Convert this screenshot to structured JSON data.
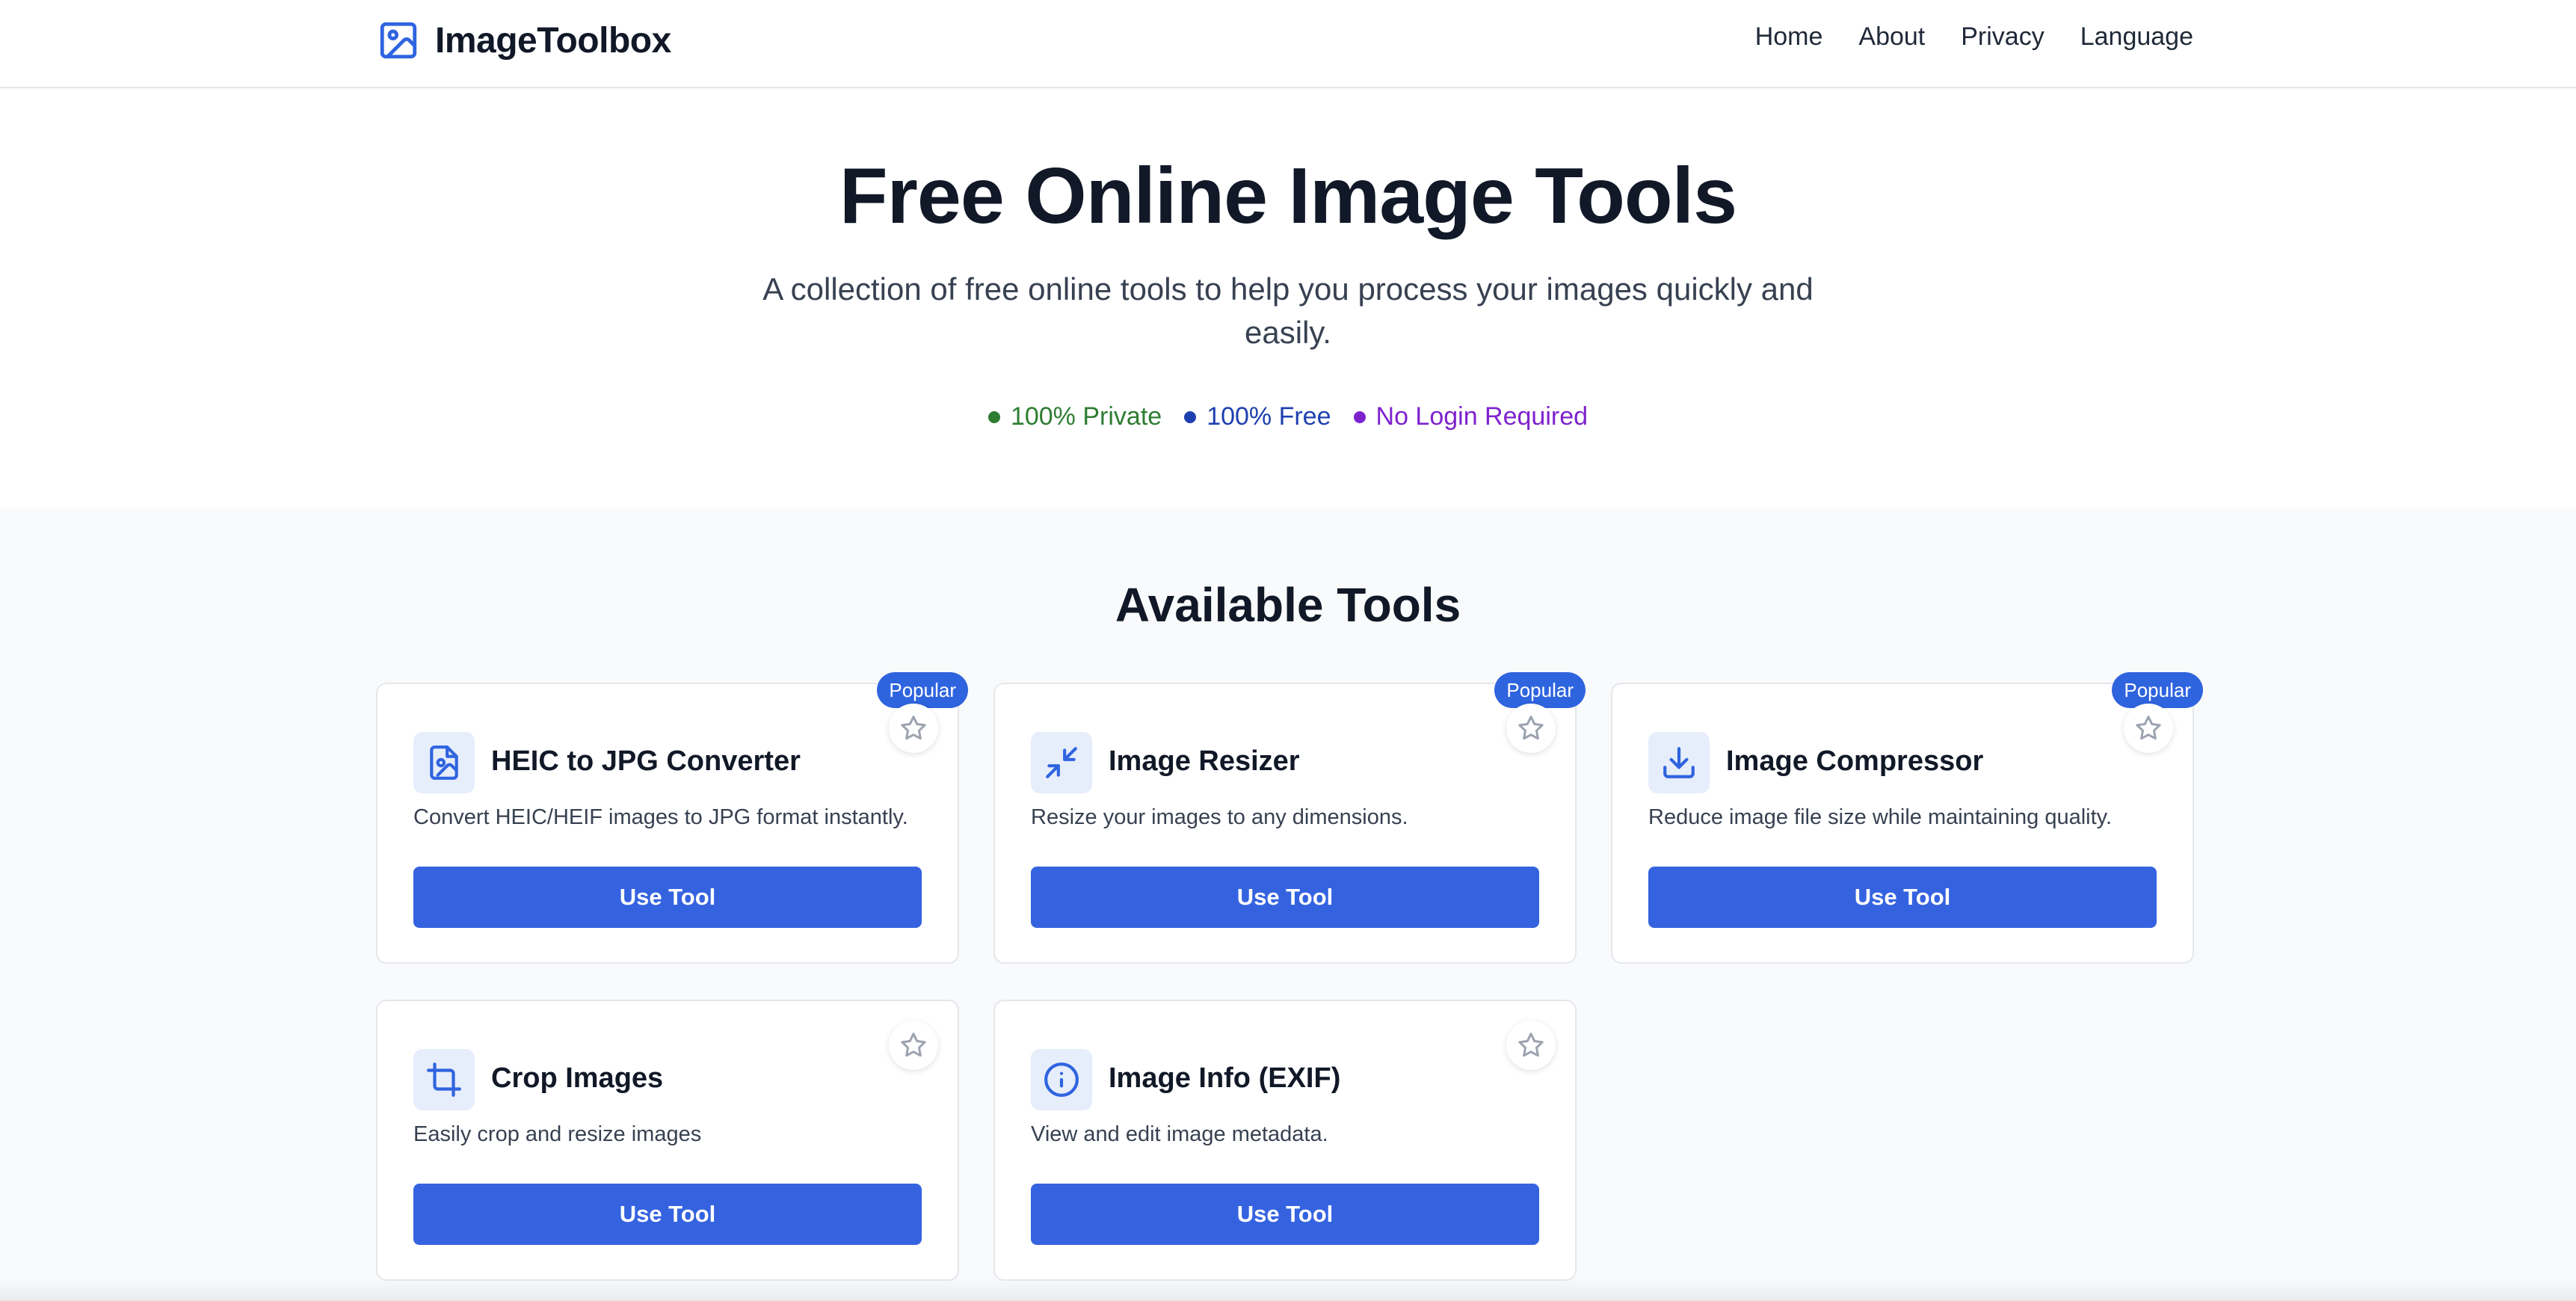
{
  "header": {
    "brand": "ImageToolbox",
    "nav": [
      "Home",
      "About",
      "Privacy",
      "Language"
    ]
  },
  "hero": {
    "title": "Free Online Image Tools",
    "subtitle": "A collection of free online tools to help you process your images quickly and easily.",
    "features": [
      {
        "label": "100% Private",
        "color": "#2e7d32"
      },
      {
        "label": "100% Free",
        "color": "#1e40af"
      },
      {
        "label": "No Login Required",
        "color": "#7e22ce"
      }
    ]
  },
  "tools_section": {
    "title": "Available Tools",
    "badge_label": "Popular",
    "button_label": "Use Tool",
    "tools": [
      {
        "name": "HEIC to JPG Converter",
        "description": "Convert HEIC/HEIF images to JPG format instantly.",
        "icon": "file-image-icon",
        "popular": true
      },
      {
        "name": "Image Resizer",
        "description": "Resize your images to any dimensions.",
        "icon": "minimize-icon",
        "popular": true
      },
      {
        "name": "Image Compressor",
        "description": "Reduce image file size while maintaining quality.",
        "icon": "download-icon",
        "popular": true
      },
      {
        "name": "Crop Images",
        "description": "Easily crop and resize images",
        "icon": "crop-icon",
        "popular": false
      },
      {
        "name": "Image Info (EXIF)",
        "description": "View and edit image metadata.",
        "icon": "info-icon",
        "popular": false
      }
    ]
  },
  "colors": {
    "accent": "#3563e0",
    "badge": "#2f64df",
    "icon_bg": "#e6edfb"
  }
}
